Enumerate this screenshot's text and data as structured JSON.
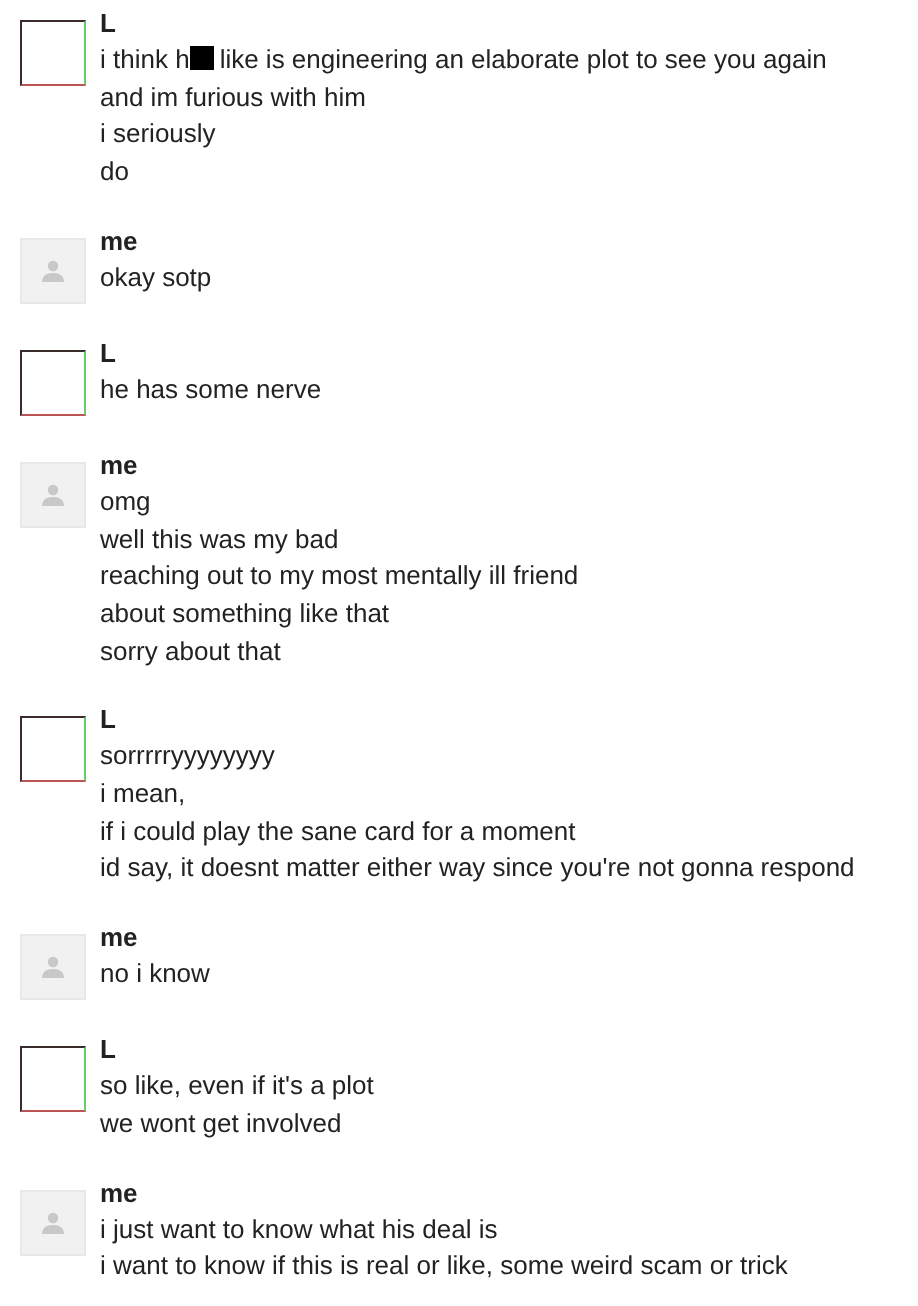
{
  "messages": [
    {
      "sender": "L",
      "kind": "photo",
      "lines": [
        {
          "kind": "redacted",
          "before": "i think h",
          "after": "like is engineering an elaborate plot to see you again"
        },
        {
          "kind": "text",
          "text": "and im furious with him"
        },
        {
          "kind": "text",
          "text": "i seriously"
        },
        {
          "kind": "text",
          "text": "do"
        }
      ]
    },
    {
      "sender": "me",
      "kind": "default",
      "lines": [
        {
          "kind": "text",
          "text": "okay sotp"
        }
      ]
    },
    {
      "sender": "L",
      "kind": "photo",
      "lines": [
        {
          "kind": "text",
          "text": "he has some nerve"
        }
      ]
    },
    {
      "sender": "me",
      "kind": "default",
      "lines": [
        {
          "kind": "text",
          "text": "omg"
        },
        {
          "kind": "text",
          "text": "well this was my bad"
        },
        {
          "kind": "text",
          "text": "reaching out to my most mentally ill friend"
        },
        {
          "kind": "text",
          "text": "about something like that"
        },
        {
          "kind": "text",
          "text": "sorry about that"
        }
      ]
    },
    {
      "sender": "L",
      "kind": "photo",
      "lines": [
        {
          "kind": "text",
          "text": "sorrrrryyyyyyyy"
        },
        {
          "kind": "text",
          "text": "i mean,"
        },
        {
          "kind": "text",
          "text": "if i could play the sane card for a moment"
        },
        {
          "kind": "text",
          "text": "id say, it doesnt matter either way since you're not gonna respond"
        }
      ]
    },
    {
      "sender": "me",
      "kind": "default",
      "lines": [
        {
          "kind": "text",
          "text": "no i know"
        }
      ]
    },
    {
      "sender": "L",
      "kind": "photo",
      "lines": [
        {
          "kind": "text",
          "text": "so like, even if it's a plot"
        },
        {
          "kind": "text",
          "text": "we wont get involved"
        }
      ]
    },
    {
      "sender": "me",
      "kind": "default",
      "lines": [
        {
          "kind": "text",
          "text": "i just want to know what his deal is"
        },
        {
          "kind": "text",
          "text": "i want to know if this is real or like, some weird scam or trick"
        }
      ]
    }
  ]
}
